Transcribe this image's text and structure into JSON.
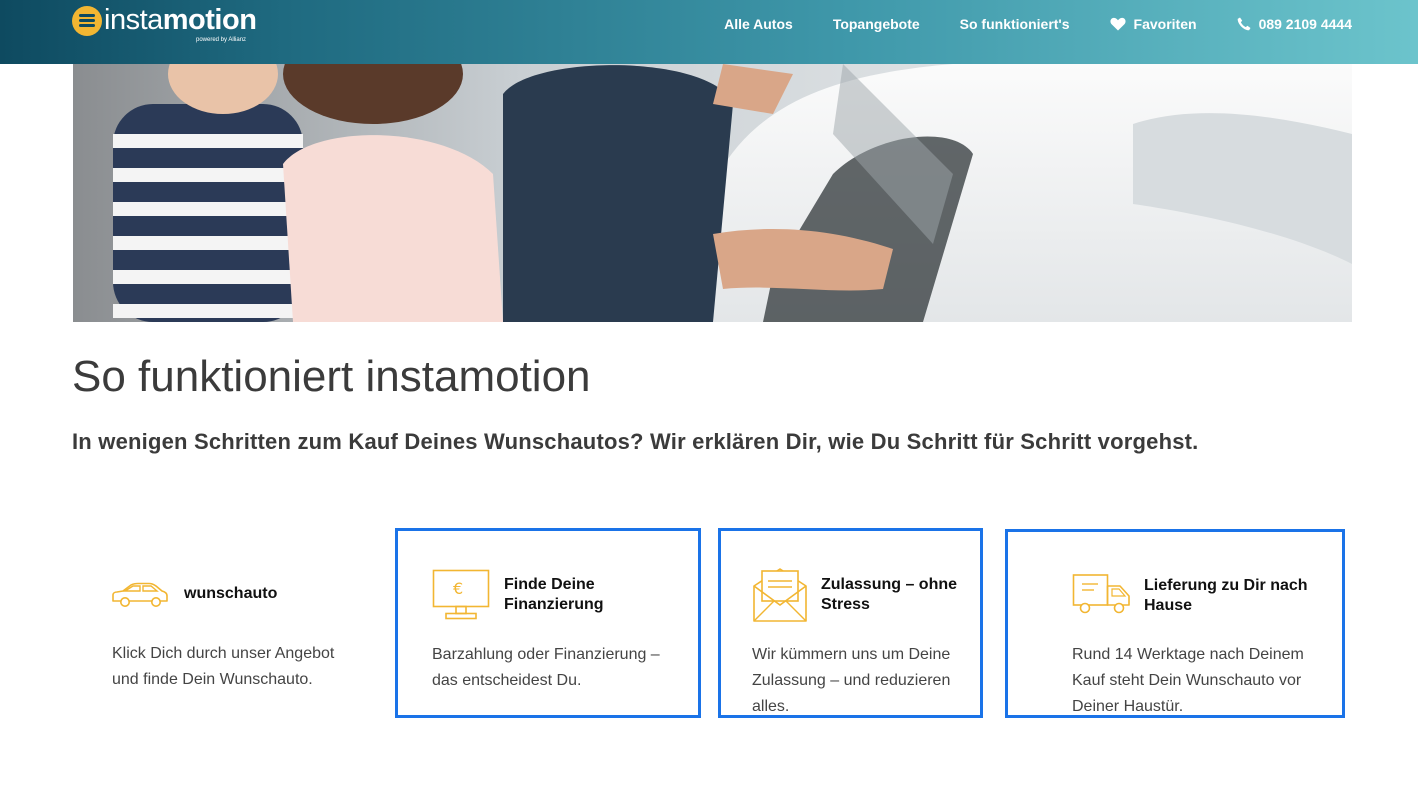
{
  "header": {
    "logo_brand_light": "insta",
    "logo_brand_bold": "motion",
    "logo_sub": "powered by Allianz",
    "nav": [
      {
        "label": "Alle Autos",
        "icon": ""
      },
      {
        "label": "Topangebote",
        "icon": ""
      },
      {
        "label": "So funktioniert's",
        "icon": ""
      },
      {
        "label": "Favoriten",
        "icon": "heart-icon"
      },
      {
        "label": "089 2109 4444",
        "icon": "phone-icon"
      }
    ]
  },
  "page": {
    "title": "So funktioniert instamotion",
    "subtitle": "In wenigen Schritten zum Kauf Deines Wunschautos? Wir erklären Dir, wie Du Schritt für Schritt vorgehst."
  },
  "steps": [
    {
      "icon": "car-icon",
      "title": "wunschauto",
      "text": "Klick Dich durch unser Angebot und finde Dein Wunschauto."
    },
    {
      "icon": "monitor-euro-icon",
      "title": "Finde Deine Finanzierung",
      "text": "Barzahlung oder Finanzierung – das entscheidest Du."
    },
    {
      "icon": "envelope-icon",
      "title": "Zulassung – ohne Stress",
      "text": "Wir kümmern uns um Deine Zulassung – und reduzieren alles."
    },
    {
      "icon": "truck-icon",
      "title": "Lieferung zu Dir nach Hause",
      "text": "Rund 14 Werktage nach Deinem Kauf steht Dein Wunschauto vor Deiner Haustür."
    }
  ],
  "colors": {
    "accent": "#f2b632",
    "highlight_border": "#1a73e8",
    "header_start": "#0e4a60",
    "header_end": "#6cc4cc"
  }
}
